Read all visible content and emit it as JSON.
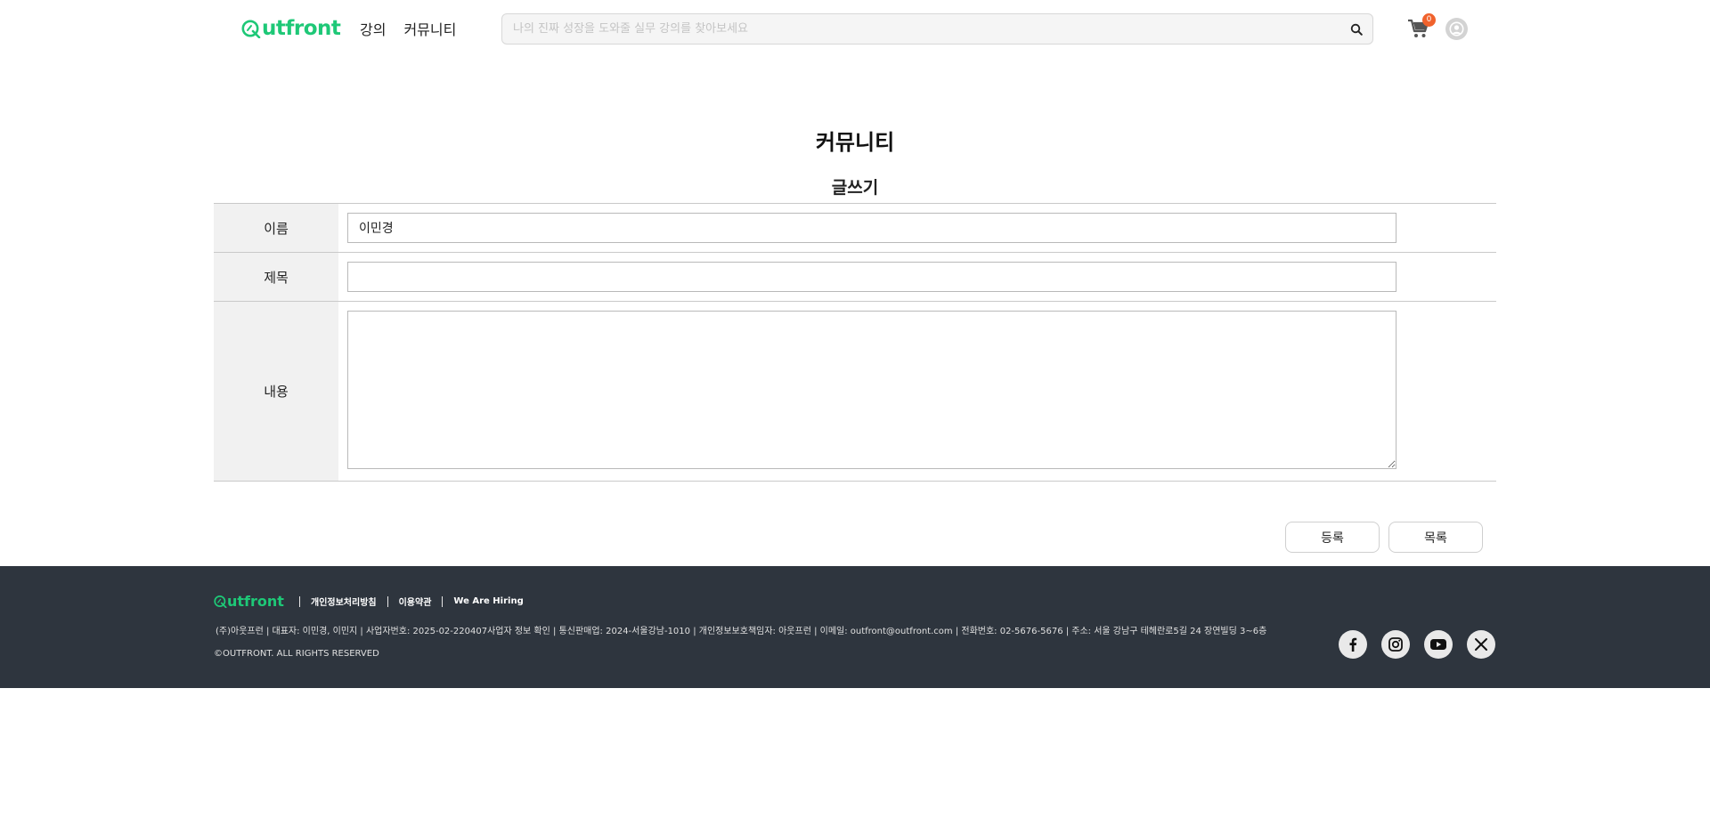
{
  "header": {
    "logo_text": "utfront",
    "nav": [
      {
        "label": "강의"
      },
      {
        "label": "커뮤니티"
      }
    ],
    "search": {
      "placeholder": "나의 진짜 성장을 도와줄 실무 강의를 찾아보세요",
      "value": ""
    },
    "cart_count": "0",
    "icons": {
      "search": "search-icon",
      "cart": "cart-icon",
      "profile": "user-avatar-icon"
    }
  },
  "main": {
    "page_title": "커뮤니티",
    "form_title": "글쓰기",
    "fields": {
      "name": {
        "label": "이름",
        "value": "이민경"
      },
      "title": {
        "label": "제목",
        "value": ""
      },
      "content": {
        "label": "내용",
        "value": ""
      }
    },
    "buttons": {
      "submit": "등록",
      "list": "목록"
    }
  },
  "footer": {
    "logo_text": "utfront",
    "links": [
      {
        "label": "개인정보처리방침"
      },
      {
        "label": "이용약관"
      },
      {
        "label": "We Are Hiring"
      }
    ],
    "info": "(주)아웃프런 |  대표자: 이민경, 이민지 |  사업자번호: 2025-02-220407사업자 정보 확인 | 통신판매업: 2024-서울강남-1010 |  개인정보보호책임자: 아웃프런 |  이메일: outfront@outfront.com | 전화번호: 02-5676-5676 |  주소: 서울 강남구 테헤란로5길 24 장연빌딩 3~6층",
    "copyright": "©OUTFRONT. ALL RIGHTS RESERVED",
    "social": [
      "facebook-icon",
      "instagram-icon",
      "youtube-icon",
      "x-icon"
    ]
  },
  "colors": {
    "brand": "#1ec877",
    "footer_bg": "#2e353e",
    "badge": "#f0622c",
    "label_bg": "#f1f1f1"
  }
}
